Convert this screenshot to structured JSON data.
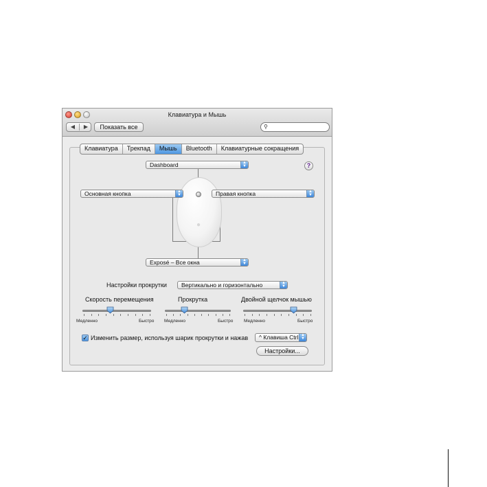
{
  "window": {
    "title": "Клавиатура и Мышь",
    "nav_back": "◀",
    "nav_forward": "▶",
    "show_all_label": "Показать все",
    "search_value": ""
  },
  "tabs": [
    {
      "label": "Клавиатура",
      "active": false
    },
    {
      "label": "Трекпад",
      "active": false
    },
    {
      "label": "Мышь",
      "active": true
    },
    {
      "label": "Bluetooth",
      "active": false
    },
    {
      "label": "Клавиатурные сокращения",
      "active": false
    }
  ],
  "mouse": {
    "top_popup": "Dashboard",
    "left_popup": "Основная кнопка",
    "right_popup": "Правая кнопка",
    "bottom_popup": "Exposé – Все окна",
    "help_label": "?"
  },
  "scrolling": {
    "label": "Настройки прокрутки",
    "value": "Вертикально и горизонтально"
  },
  "sliders": [
    {
      "title": "Скорость перемещения",
      "min_label": "Медленно",
      "max_label": "Быстро",
      "value": 0.4
    },
    {
      "title": "Прокрутка",
      "min_label": "Медленно",
      "max_label": "Быстро",
      "value": 0.3
    },
    {
      "title": "Двойной щелчок мышью",
      "min_label": "Медленно",
      "max_label": "Быстро",
      "value": 0.73
    }
  ],
  "zoom": {
    "checked": true,
    "label": "Изменить размер, используя шарик прокрутки и нажав",
    "key_popup": "^ Клавиша Ctrl",
    "settings_button": "Настройки..."
  },
  "colors": {
    "accent": "#4e97e2",
    "window_bg": "#ececec"
  }
}
